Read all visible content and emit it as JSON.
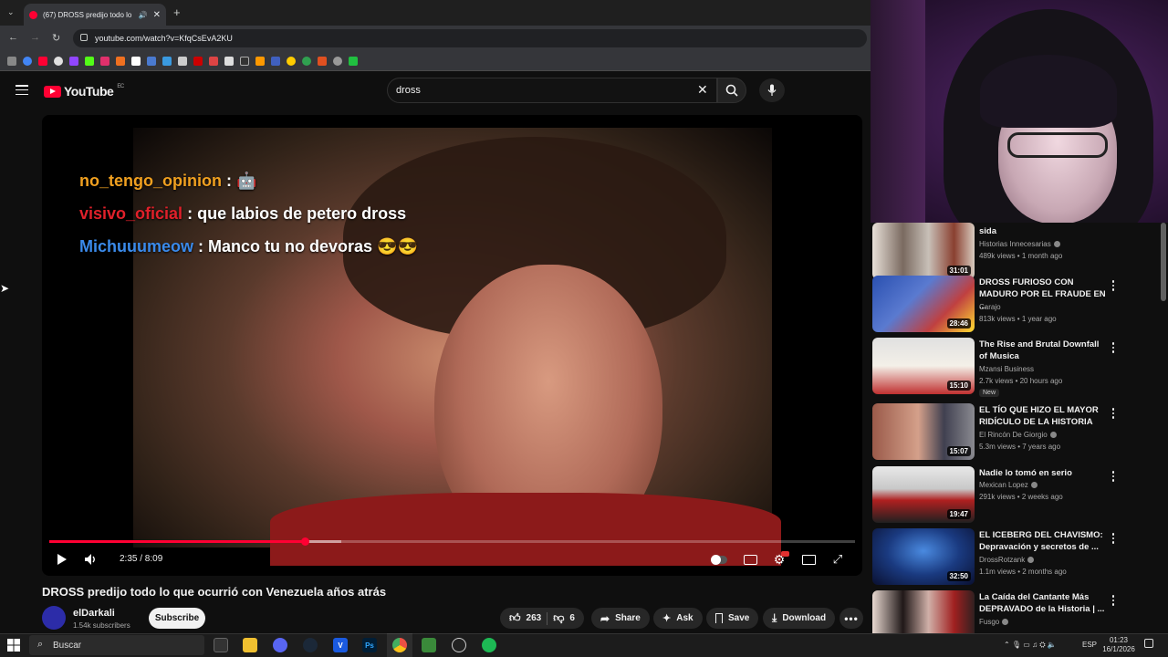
{
  "browser": {
    "tab_title": "(67) DROSS predijo todo lo",
    "url": "youtube.com/watch?v=KfqCsEvA2KU"
  },
  "youtube": {
    "logo_text": "YouTube",
    "region": "EC",
    "search_value": "dross"
  },
  "player": {
    "chat": [
      {
        "user": "no_tengo_opinion",
        "user_color": "#f0a020",
        "message": ": 🤖"
      },
      {
        "user": "visivo_oficial",
        "user_color": "#e0202a",
        "message": ": que labios de petero dross"
      },
      {
        "user": "Michuuumeow",
        "user_color": "#3a8aea",
        "message": ": Manco tu no devoras 😎😎"
      }
    ],
    "time_display": "2:35 / 8:09",
    "progress_fraction": 0.317
  },
  "video": {
    "title": "DROSS predijo todo lo que ocurrió con Venezuela años atrás",
    "channel": "elDarkali",
    "subscribers": "1.54k subscribers",
    "subscribe_label": "Subscribe",
    "likes": "263",
    "dislikes": "6",
    "share_label": "Share",
    "ask_label": "Ask",
    "save_label": "Save",
    "download_label": "Download"
  },
  "recommendations": [
    {
      "title": "sida",
      "channel": "Historias Innecesarias",
      "verified": true,
      "meta": "489k views • 1 month ago",
      "duration": "31:01",
      "thumb_color": "#c8c0b8",
      "new": false
    },
    {
      "title": "DROSS FURIOSO CON MADURO POR EL FRAUDE EN ...",
      "channel": "Carajo",
      "verified": false,
      "meta": "813k views • 1 year ago",
      "duration": "28:46",
      "thumb_color": "#2a4a9a",
      "new": false
    },
    {
      "title": "The Rise and Brutal Downfall of Musica",
      "channel": "Mzansi Business",
      "verified": false,
      "meta": "2.7k views • 20 hours ago",
      "duration": "15:10",
      "thumb_color": "#e8e4dc",
      "new": true,
      "new_label": "New"
    },
    {
      "title": "EL TÍO QUE HIZO EL MAYOR RIDÍCULO DE LA HISTORIA",
      "channel": "El Rincón De Giorgio",
      "verified": true,
      "meta": "5.3m views • 7 years ago",
      "duration": "15:07",
      "thumb_color": "#b8867a",
      "new": false
    },
    {
      "title": "Nadie lo tomó en serio",
      "channel": "Mexican Lopez",
      "verified": true,
      "meta": "291k views • 2 weeks ago",
      "duration": "19:47",
      "thumb_color": "#d0d0d0",
      "new": false
    },
    {
      "title": "EL ICEBERG DEL CHAVISMO: Depravación y secretos de ...",
      "channel": "DrossRotzank",
      "verified": true,
      "meta": "1.1m views • 2 months ago",
      "duration": "32:50",
      "thumb_color": "#1a3a6a",
      "new": false
    },
    {
      "title": "La Caída del Cantante Más DEPRAVADO de la Historia | ...",
      "channel": "Fusgo",
      "verified": true,
      "meta": "",
      "duration": "",
      "thumb_color": "#8a2a2a",
      "new": false
    }
  ],
  "taskbar": {
    "search_label": "Buscar",
    "language": "ESP",
    "time": "01:23",
    "date": "16/1/2026"
  }
}
